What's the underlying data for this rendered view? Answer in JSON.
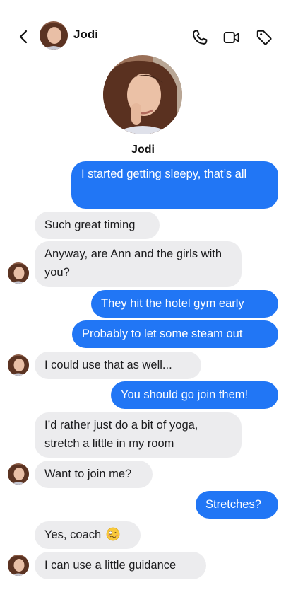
{
  "contact": {
    "name": "Jodi"
  },
  "icons": {
    "back": "chevron-left-icon",
    "phone": "phone-icon",
    "video": "video-camera-icon",
    "tag": "tag-icon"
  },
  "colors": {
    "outgoing_bubble": "#2176f5",
    "incoming_bubble": "#ececee",
    "outgoing_text": "#ffffff",
    "incoming_text": "#1c1c1e"
  },
  "messages": [
    {
      "from": "me",
      "text": "I started getting sleepy, that’s all"
    },
    {
      "from": "Jodi",
      "text": "Such great timing"
    },
    {
      "from": "Jodi",
      "text": "Anyway, are Ann and the girls with you?"
    },
    {
      "from": "me",
      "text": "They hit the hotel gym early"
    },
    {
      "from": "me",
      "text": "Probably to let some steam out"
    },
    {
      "from": "Jodi",
      "text": "I could use that as well..."
    },
    {
      "from": "me",
      "text": "You should go join them!"
    },
    {
      "from": "Jodi",
      "text": "I’d rather just do a bit of yoga, stretch a little in my room"
    },
    {
      "from": "Jodi",
      "text": "Want to join me?"
    },
    {
      "from": "me",
      "text": "Stretches?"
    },
    {
      "from": "Jodi",
      "text": "Yes, coach",
      "emoji": "🥴"
    },
    {
      "from": "Jodi",
      "text": "I can use a little guidance"
    }
  ]
}
